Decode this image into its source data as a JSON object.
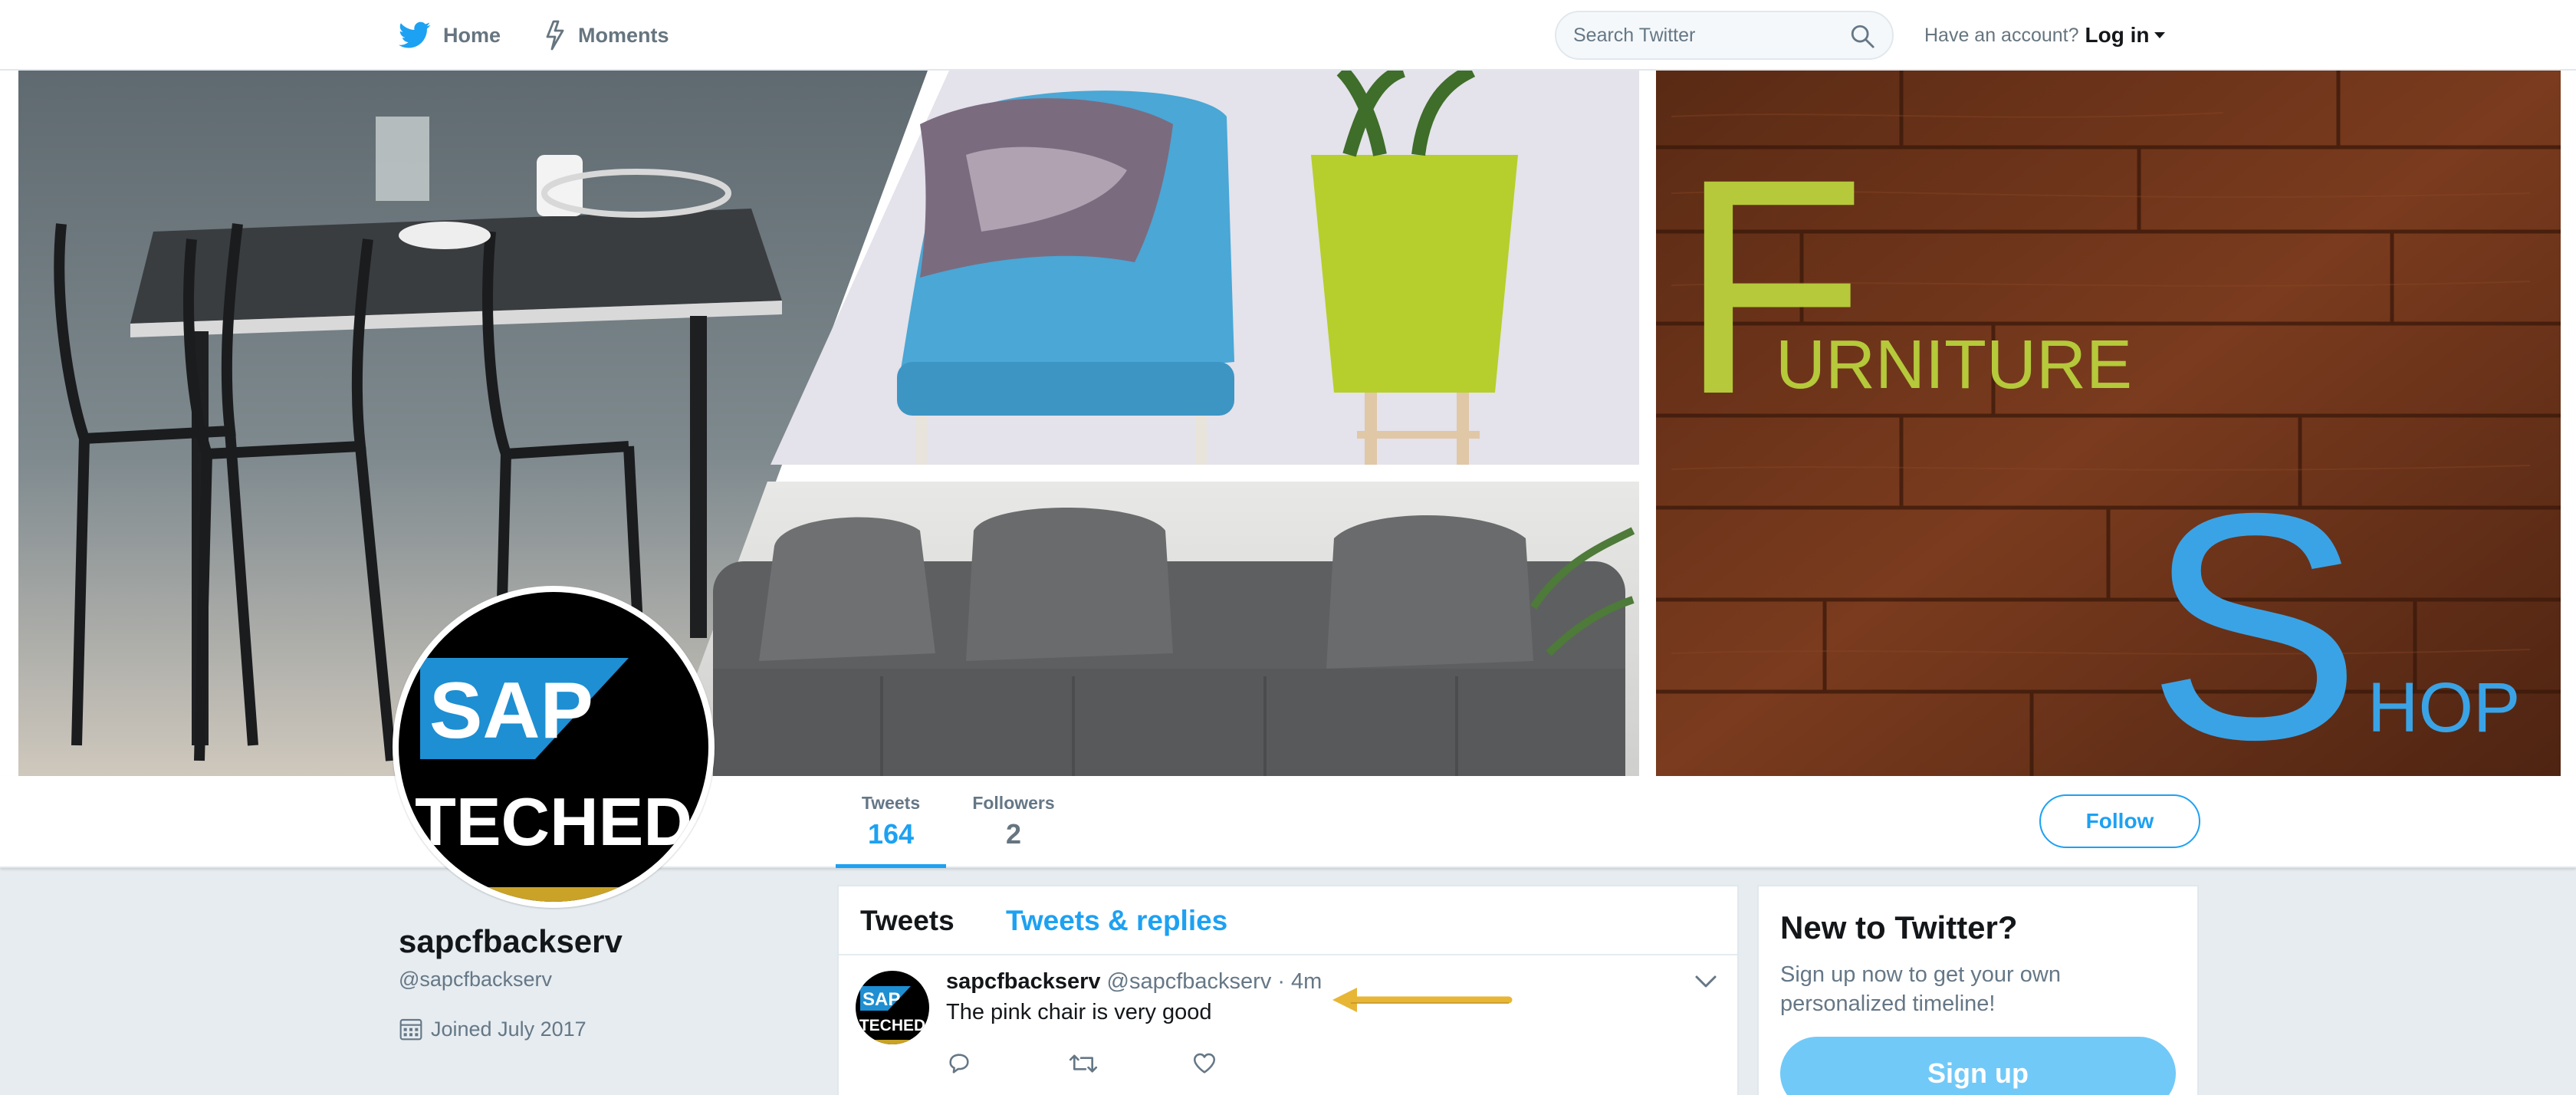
{
  "topbar": {
    "home_label": "Home",
    "moments_label": "Moments",
    "search_placeholder": "Search Twitter",
    "account_prompt": "Have an account?",
    "login_label": "Log in"
  },
  "banner": {
    "brand_letter_f": "F",
    "brand_word_1": "URNITURE",
    "brand_letter_s": "S",
    "brand_word_2": "HOP"
  },
  "avatar": {
    "logo_top": "SAP",
    "logo_bottom": "TECHED"
  },
  "stats": {
    "tweets_label": "Tweets",
    "tweets_value": "164",
    "followers_label": "Followers",
    "followers_value": "2"
  },
  "follow_label": "Follow",
  "profile": {
    "name": "sapcfbackserv",
    "handle": "@sapcfbackserv",
    "joined": "Joined July 2017"
  },
  "timeline": {
    "tab_tweets": "Tweets",
    "tab_replies": "Tweets & replies",
    "tweet": {
      "name": "sapcfbackserv",
      "handle": "@sapcfbackserv",
      "separator": "·",
      "time": "4m",
      "text": "The pink chair is very good",
      "avatar_top": "SAP",
      "avatar_bottom": "TECHED"
    }
  },
  "signup": {
    "title": "New to Twitter?",
    "subtitle": "Sign up now to get your own personalized timeline!",
    "button": "Sign up"
  },
  "colors": {
    "accent": "#1da1f2",
    "signup_button": "#71c9f8",
    "page_background": "#e6ecf0",
    "brand_green": "#b5c93a",
    "brand_blue": "#3aa3e6",
    "annotation_arrow": "#e8b635"
  },
  "icons": {
    "home": "twitter-bird-icon",
    "moments": "lightning-icon",
    "search": "search-icon",
    "joined": "calendar-icon",
    "reply": "reply-icon",
    "retweet": "retweet-icon",
    "like": "heart-icon",
    "tweet_menu": "chevron-down-icon"
  }
}
